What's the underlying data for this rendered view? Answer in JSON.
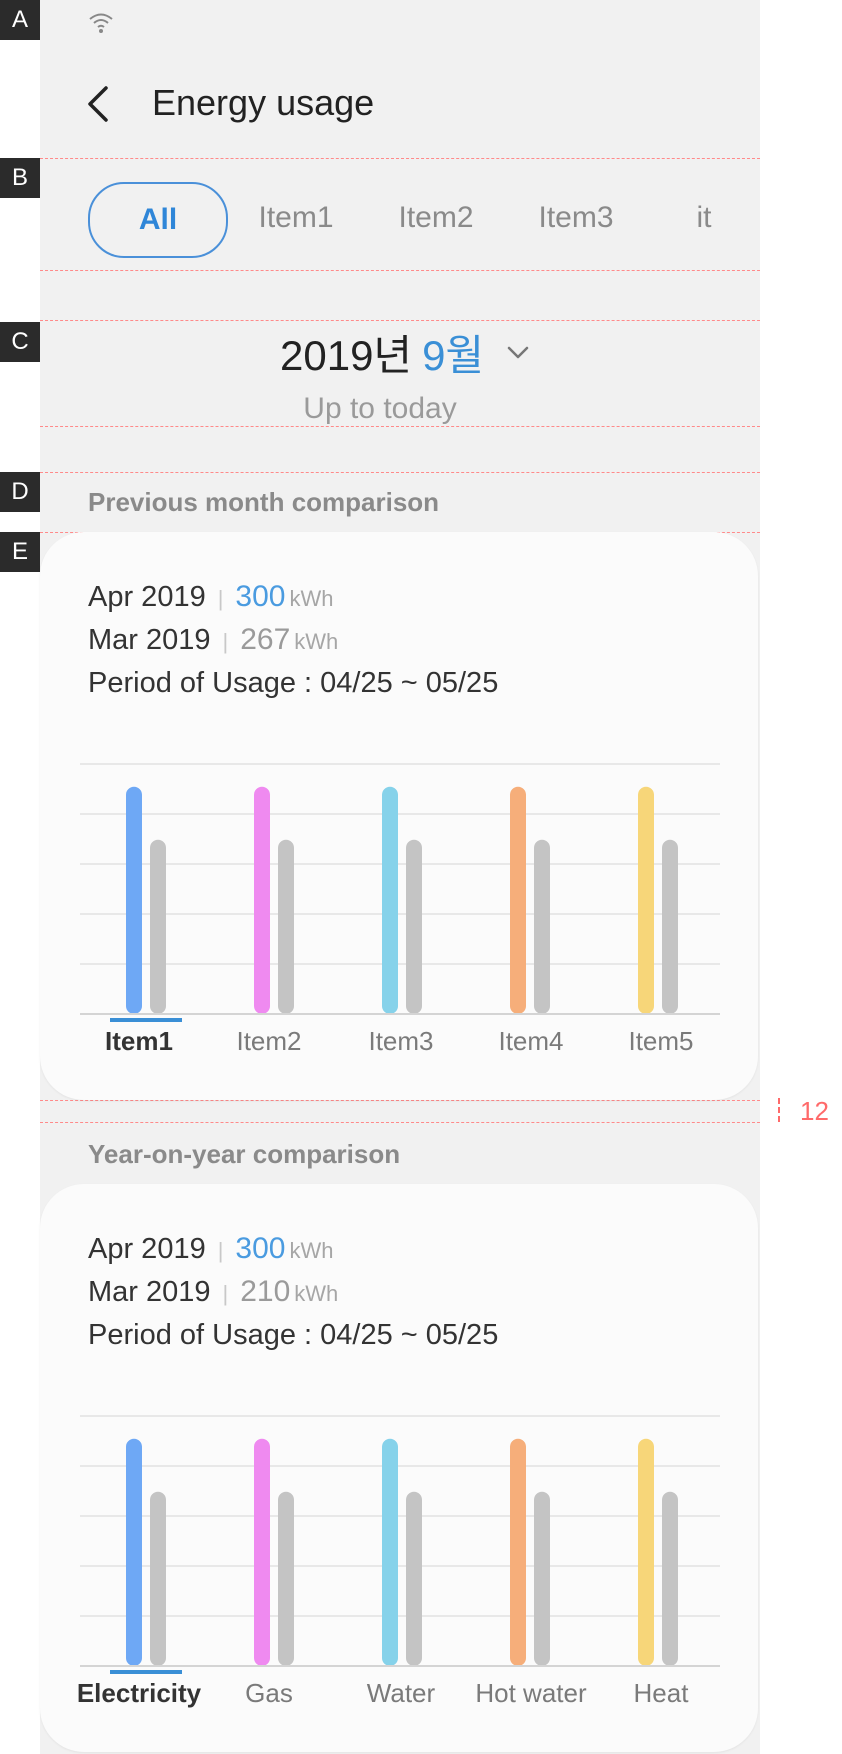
{
  "annotations": [
    "A",
    "B",
    "C",
    "D",
    "E"
  ],
  "header": {
    "title": "Energy usage"
  },
  "tabs": [
    {
      "label": "All",
      "active": true
    },
    {
      "label": "Item1"
    },
    {
      "label": "Item2"
    },
    {
      "label": "Item3"
    },
    {
      "label": "it"
    }
  ],
  "period_selector": {
    "year": "2019년",
    "month": "9월",
    "subtitle": "Up to today"
  },
  "sections": [
    {
      "heading": "Previous month comparison",
      "current": {
        "label": "Apr 2019",
        "value": "300",
        "unit": "kWh"
      },
      "previous": {
        "label": "Mar 2019",
        "value": "267",
        "unit": "kWh"
      },
      "period": "Period of Usage : 04/25 ~ 05/25",
      "categories": [
        {
          "label": "Item1",
          "active": true
        },
        {
          "label": "Item2"
        },
        {
          "label": "Item3"
        },
        {
          "label": "Item4"
        },
        {
          "label": "Item5"
        }
      ]
    },
    {
      "heading": "Year-on-year comparison",
      "current": {
        "label": "Apr 2019",
        "value": "300",
        "unit": "kWh"
      },
      "previous": {
        "label": "Mar 2019",
        "value": "210",
        "unit": "kWh"
      },
      "period": "Period of Usage : 04/25 ~ 05/25",
      "categories": [
        {
          "label": "Electricity",
          "active": true
        },
        {
          "label": "Gas"
        },
        {
          "label": "Water"
        },
        {
          "label": "Hot water"
        },
        {
          "label": "Heat"
        }
      ]
    }
  ],
  "dimension_label": "12",
  "colors": {
    "accent": "#4a9be0",
    "bar_previous": "#c4c4c4",
    "bars": [
      "#6ea8f5",
      "#ef8af0",
      "#86d2ea",
      "#f6ae7a",
      "#f7d679"
    ]
  },
  "chart_data": [
    {
      "type": "bar",
      "categories": [
        "Item1",
        "Item2",
        "Item3",
        "Item4",
        "Item5"
      ],
      "series": [
        {
          "values": [
            300,
            300,
            300,
            300,
            300
          ]
        },
        {
          "values": [
            230,
            230,
            230,
            230,
            230
          ]
        }
      ],
      "ylim": [
        0,
        330
      ],
      "grid": true
    },
    {
      "type": "bar",
      "categories": [
        "Electricity",
        "Gas",
        "Water",
        "Hot water",
        "Heat"
      ],
      "series": [
        {
          "values": [
            300,
            300,
            300,
            300,
            300
          ]
        },
        {
          "values": [
            230,
            230,
            230,
            230,
            230
          ]
        }
      ],
      "ylim": [
        0,
        330
      ],
      "grid": true
    }
  ]
}
